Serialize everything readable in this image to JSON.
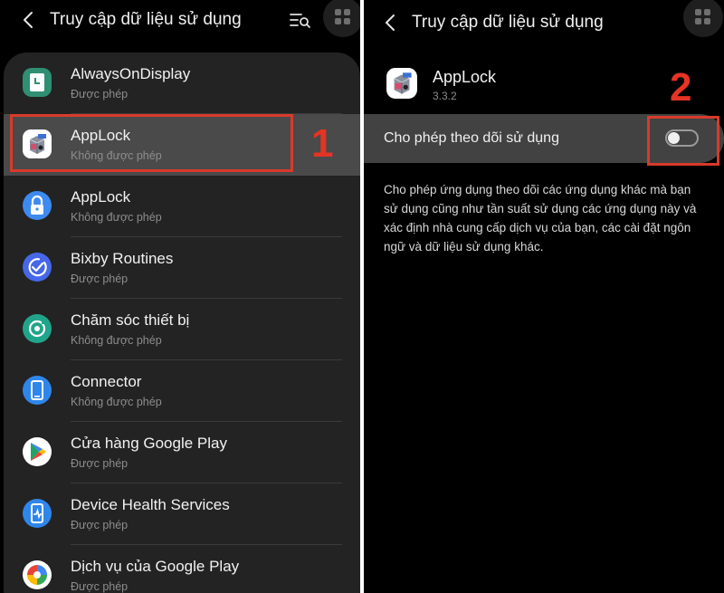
{
  "left": {
    "title": "Truy cập dữ liệu sử dụng",
    "items": [
      {
        "label": "AlwaysOnDisplay",
        "status": "Được phép",
        "icon": "always-on-display-icon"
      },
      {
        "label": "AppLock",
        "status": "Không được phép",
        "icon": "applock-cube-icon"
      },
      {
        "label": "AppLock",
        "status": "Không được phép",
        "icon": "applock-padlock-icon"
      },
      {
        "label": "Bixby Routines",
        "status": "Được phép",
        "icon": "bixby-routines-icon"
      },
      {
        "label": "Chăm sóc thiết bị",
        "status": "Không được phép",
        "icon": "device-care-icon"
      },
      {
        "label": "Connector",
        "status": "Không được phép",
        "icon": "connector-icon"
      },
      {
        "label": "Cửa hàng Google Play",
        "status": "Được phép",
        "icon": "google-play-store-icon"
      },
      {
        "label": "Device Health Services",
        "status": "Được phép",
        "icon": "device-health-icon"
      },
      {
        "label": "Dịch vụ của Google Play",
        "status": "Được phép",
        "icon": "google-play-services-icon"
      }
    ]
  },
  "right": {
    "title": "Truy cập dữ liệu sử dụng",
    "app_name": "AppLock",
    "app_version": "3.3.2",
    "toggle_label": "Cho phép theo dõi sử dụng",
    "toggle_on": false,
    "description": "Cho phép ứng dụng theo dõi các ứng dụng khác mà bạn sử dụng cũng như tần suất sử dụng các ứng dụng này và xác định nhà cung cấp dịch vụ của bạn, các cài đặt ngôn ngữ và dữ liệu sử dụng khác."
  },
  "annotations": {
    "step1": "1",
    "step2": "2"
  },
  "colors": {
    "highlight": "#d83a2c",
    "step_number": "#e53324"
  }
}
